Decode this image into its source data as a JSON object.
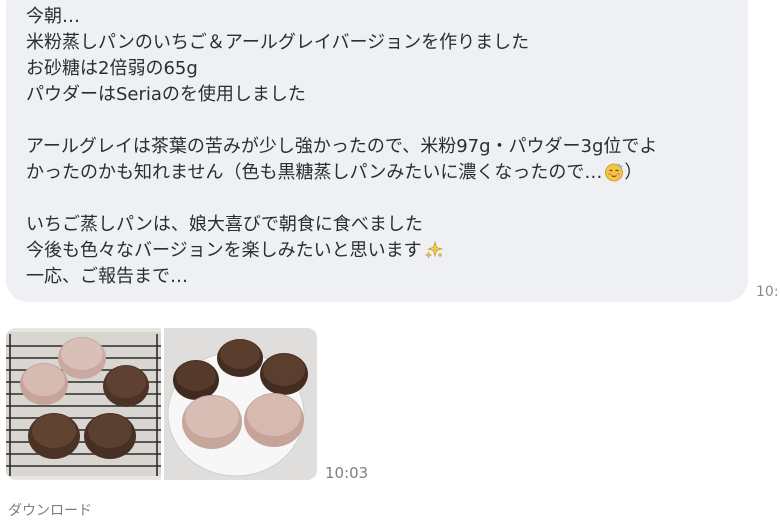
{
  "message": {
    "lines": [
      "今朝…",
      "米粉蒸しパンのいちご＆アールグレイバージョンを作りました",
      "お砂糖は2倍弱の65g",
      "パウダーはSeriaのを使用しました",
      "",
      "アールグレイは茶葉の苦みが少し強かったので、米粉97g・パウダー3g位でよ",
      "かったのかも知れません（色も黒糖蒸しパンみたいに濃くなったので…",
      "",
      "いちご蒸しパンは、娘大喜びで朝食に食べました",
      "今後も色々なバージョンを楽しみたいと思います",
      "一応、ご報告まで…"
    ],
    "line7_suffix": "）",
    "emoji_line7": "embarrassed-face-emoji",
    "emoji_line10": "sparkles-emoji",
    "time": "10:"
  },
  "photos": {
    "time": "10:03",
    "download_label": "ダウンロード"
  },
  "colors": {
    "bubble": "#eef0f3",
    "text": "#2b2d31",
    "timestamp": "#888b90"
  }
}
